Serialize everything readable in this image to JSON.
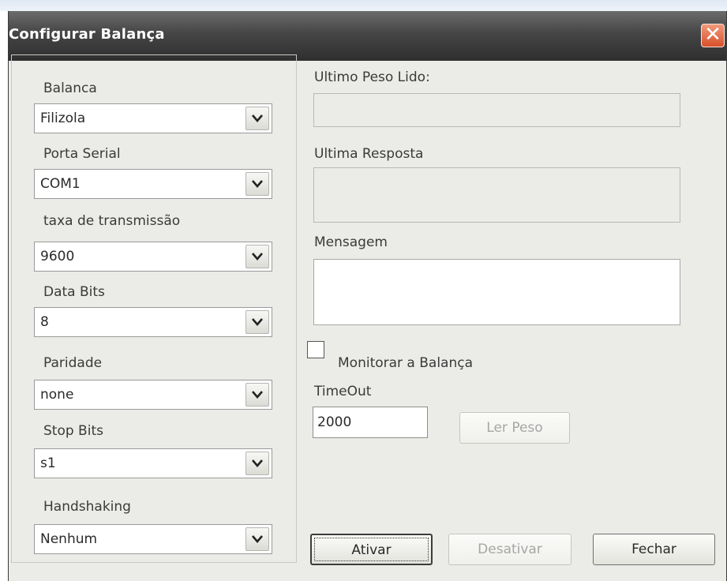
{
  "window": {
    "title": "Configurar Balança",
    "close_glyph": "✕",
    "close_icon": "close-icon"
  },
  "settings": {
    "balanca": {
      "label": "Balanca",
      "value": "Filizola"
    },
    "porta_serial": {
      "label": "Porta Serial",
      "value": "COM1"
    },
    "taxa": {
      "label": "taxa de transmissão",
      "value": "9600"
    },
    "data_bits": {
      "label": "Data Bits",
      "value": "8"
    },
    "paridade": {
      "label": "Paridade",
      "value": "none"
    },
    "stop_bits": {
      "label": "Stop Bits",
      "value": "s1"
    },
    "handshaking": {
      "label": "Handshaking",
      "value": "Nenhum"
    },
    "dropdown_icon": "chevron-down-icon"
  },
  "status": {
    "ultimo_peso_label": "Ultimo Peso Lido:",
    "ultimo_peso_value": "",
    "ultima_resposta_label": "Ultima Resposta",
    "ultima_resposta_value": "",
    "mensagem_label": "Mensagem",
    "mensagem_value": ""
  },
  "monitor": {
    "checkbox_label": "Monitorar a Balança",
    "checked": false
  },
  "timeout": {
    "label": "TimeOut",
    "value": "2000"
  },
  "buttons": {
    "ler_peso": "Ler Peso",
    "ativar": "Ativar",
    "desativar": "Desativar",
    "fechar": "Fechar"
  },
  "colors": {
    "titlebar": "#454545",
    "dialog_bg": "#ebebe7",
    "close_button": "#d8502a",
    "disabled_text": "#a6a6a6"
  }
}
